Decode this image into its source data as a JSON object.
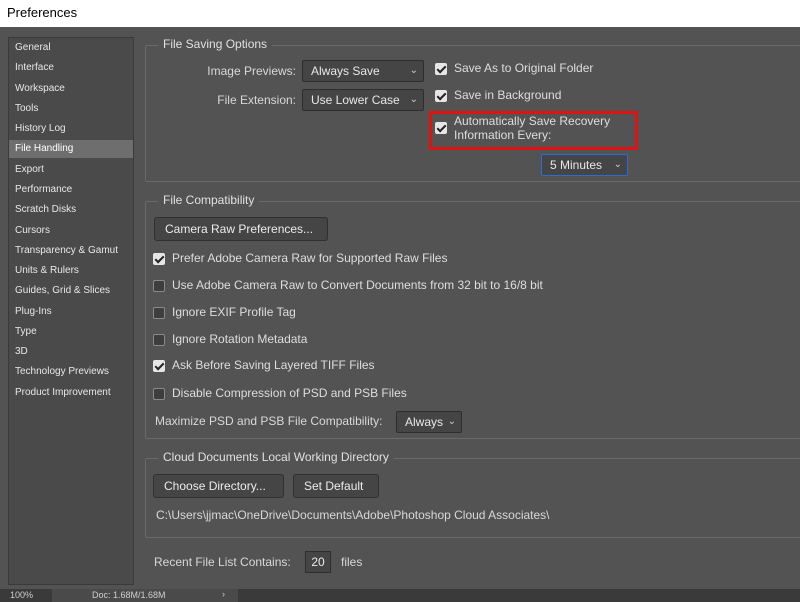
{
  "window": {
    "title": "Preferences"
  },
  "sidebar": {
    "items": [
      {
        "label": "General"
      },
      {
        "label": "Interface"
      },
      {
        "label": "Workspace"
      },
      {
        "label": "Tools"
      },
      {
        "label": "History Log"
      },
      {
        "label": "File Handling",
        "selected": true
      },
      {
        "label": "Export"
      },
      {
        "label": "Performance"
      },
      {
        "label": "Scratch Disks"
      },
      {
        "label": "Cursors"
      },
      {
        "label": "Transparency & Gamut"
      },
      {
        "label": "Units & Rulers"
      },
      {
        "label": "Guides, Grid & Slices"
      },
      {
        "label": "Plug-Ins"
      },
      {
        "label": "Type"
      },
      {
        "label": "3D"
      },
      {
        "label": "Technology Previews"
      },
      {
        "label": "Product Improvement"
      }
    ]
  },
  "file_saving": {
    "title": "File Saving Options",
    "image_previews_label": "Image Previews:",
    "image_previews_value": "Always Save",
    "file_extension_label": "File Extension:",
    "file_extension_value": "Use Lower Case",
    "save_as_original_folder": {
      "label": "Save As to Original Folder",
      "checked": true
    },
    "save_in_background": {
      "label": "Save in Background",
      "checked": true
    },
    "auto_save_line1": "Automatically Save Recovery",
    "auto_save_line2": "Information Every:",
    "auto_save_checked": true,
    "auto_save_interval": "5 Minutes"
  },
  "file_compat": {
    "title": "File Compatibility",
    "camera_raw_button": "Camera Raw Preferences...",
    "options": [
      {
        "label": "Prefer Adobe Camera Raw for Supported Raw Files",
        "checked": true
      },
      {
        "label": "Use Adobe Camera Raw to Convert Documents from 32 bit to 16/8 bit",
        "checked": false
      },
      {
        "label": "Ignore EXIF Profile Tag",
        "checked": false
      },
      {
        "label": "Ignore Rotation Metadata",
        "checked": false
      },
      {
        "label": "Ask Before Saving Layered TIFF Files",
        "checked": true
      },
      {
        "label": "Disable Compression of PSD and PSB Files",
        "checked": false
      }
    ],
    "maximize_label": "Maximize PSD and PSB File Compatibility:",
    "maximize_value": "Always"
  },
  "cloud": {
    "title": "Cloud Documents Local Working Directory",
    "choose_button": "Choose Directory...",
    "default_button": "Set Default",
    "path": "C:\\Users\\jjmac\\OneDrive\\Documents\\Adobe\\Photoshop Cloud Associates\\"
  },
  "recent": {
    "label": "Recent File List Contains:",
    "value": "20",
    "unit": "files"
  },
  "status": {
    "zoom": "100%",
    "doc": "Doc: 1.68M/1.68M",
    "arrow": "›"
  },
  "colors": {
    "panel_bg": "#535353",
    "highlight_border": "#e01212",
    "focus_border": "#2d6bd6"
  }
}
